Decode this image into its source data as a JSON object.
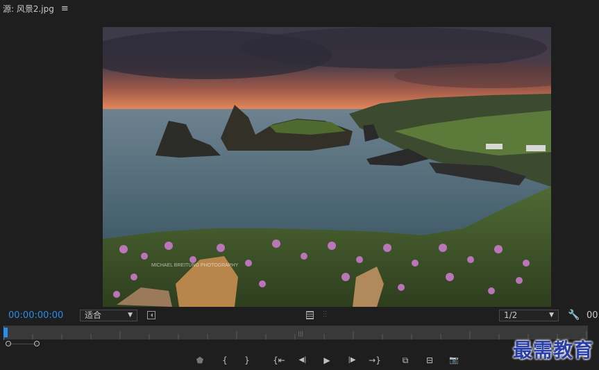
{
  "header": {
    "title": "源: 风景2.jpg",
    "menu_icon": "hamburger-icon",
    "menu_glyph": "≡"
  },
  "viewer": {
    "image_description_icon": "landscape-photo",
    "watermark_text": "MICHAEL BREITUNG PHOTOGRAPHY"
  },
  "controls": {
    "timecode": "00:00:00:00",
    "fit_value": "适合",
    "resolution_value": "1/2",
    "duration_timecode": "00:",
    "accent_color": "#2d8ceb"
  },
  "transport": {
    "buttons": [
      {
        "name": "add-marker-button",
        "glyph": "⬟"
      },
      {
        "name": "mark-in-button",
        "glyph": "{"
      },
      {
        "name": "mark-out-button",
        "glyph": "}"
      },
      {
        "name": "go-to-in-button",
        "glyph": "{⇤"
      },
      {
        "name": "step-back-button",
        "glyph": "◀|"
      },
      {
        "name": "play-button",
        "glyph": "▶"
      },
      {
        "name": "step-forward-button",
        "glyph": "|▶"
      },
      {
        "name": "go-to-out-button",
        "glyph": "→}"
      },
      {
        "name": "insert-button",
        "glyph": "⧉"
      },
      {
        "name": "overwrite-button",
        "glyph": "⊟"
      },
      {
        "name": "export-frame-button",
        "glyph": "📷"
      }
    ]
  },
  "brand": {
    "watermark": "最需教育"
  }
}
